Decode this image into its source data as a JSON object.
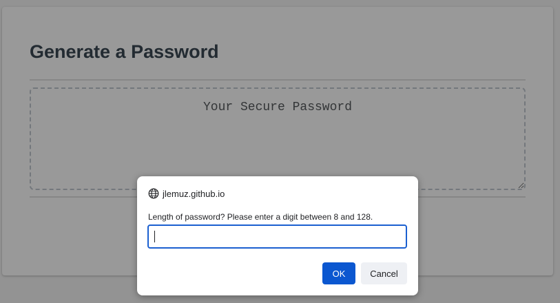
{
  "page": {
    "card_title": "Generate a Password",
    "password_placeholder": "Your Secure Password",
    "password_value": ""
  },
  "dialog": {
    "origin": "jlemuz.github.io",
    "origin_icon": "globe-icon",
    "message": "Length of password? Please enter a digit between 8 and 128.",
    "input_value": "",
    "ok_label": "OK",
    "cancel_label": "Cancel"
  },
  "colors": {
    "ok_button": "#0b57d0",
    "input_focus_border": "#1a5fd0",
    "title_text": "#3a4a57"
  }
}
